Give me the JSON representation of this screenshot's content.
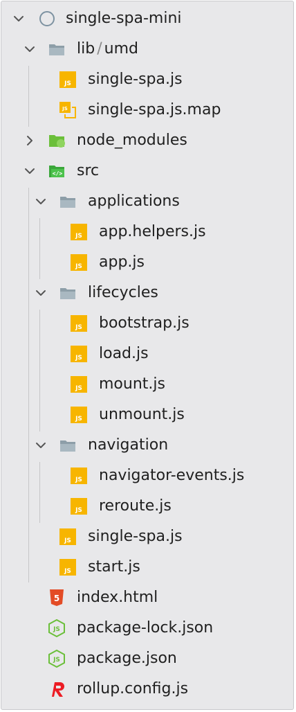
{
  "tree": {
    "root": {
      "label": "single-spa-mini",
      "icon": "circle-icon"
    },
    "lib_folder": {
      "label_a": "lib",
      "separator": "/",
      "label_b": "umd",
      "icon": "folder-icon"
    },
    "lib_files": [
      {
        "label": "single-spa.js",
        "icon": "js-file-icon"
      },
      {
        "label": "single-spa.js.map",
        "icon": "js-map-file-icon"
      }
    ],
    "node_modules": {
      "label": "node_modules",
      "icon": "node-folder-icon"
    },
    "src": {
      "label": "src",
      "icon": "src-folder-icon"
    },
    "applications": {
      "label": "applications",
      "icon": "folder-icon",
      "files": [
        {
          "label": "app.helpers.js"
        },
        {
          "label": "app.js"
        }
      ]
    },
    "lifecycles": {
      "label": "lifecycles",
      "icon": "folder-icon",
      "files": [
        {
          "label": "bootstrap.js"
        },
        {
          "label": "load.js"
        },
        {
          "label": "mount.js"
        },
        {
          "label": "unmount.js"
        }
      ]
    },
    "navigation": {
      "label": "navigation",
      "icon": "folder-icon",
      "files": [
        {
          "label": "navigator-events.js"
        },
        {
          "label": "reroute.js"
        }
      ]
    },
    "src_files": [
      {
        "label": "single-spa.js"
      },
      {
        "label": "start.js"
      }
    ],
    "root_files": [
      {
        "label": "index.html",
        "icon": "html5-icon"
      },
      {
        "label": "package-lock.json",
        "icon": "nodejs-icon"
      },
      {
        "label": "package.json",
        "icon": "nodejs-icon"
      },
      {
        "label": "rollup.config.js",
        "icon": "rollup-icon"
      }
    ]
  },
  "colors": {
    "js_yellow": "#f7b500",
    "folder_gray": "#8d9ea8",
    "node_green": "#6bbf3a",
    "html_red": "#e34c26",
    "rollup_red": "#ec1c24"
  }
}
